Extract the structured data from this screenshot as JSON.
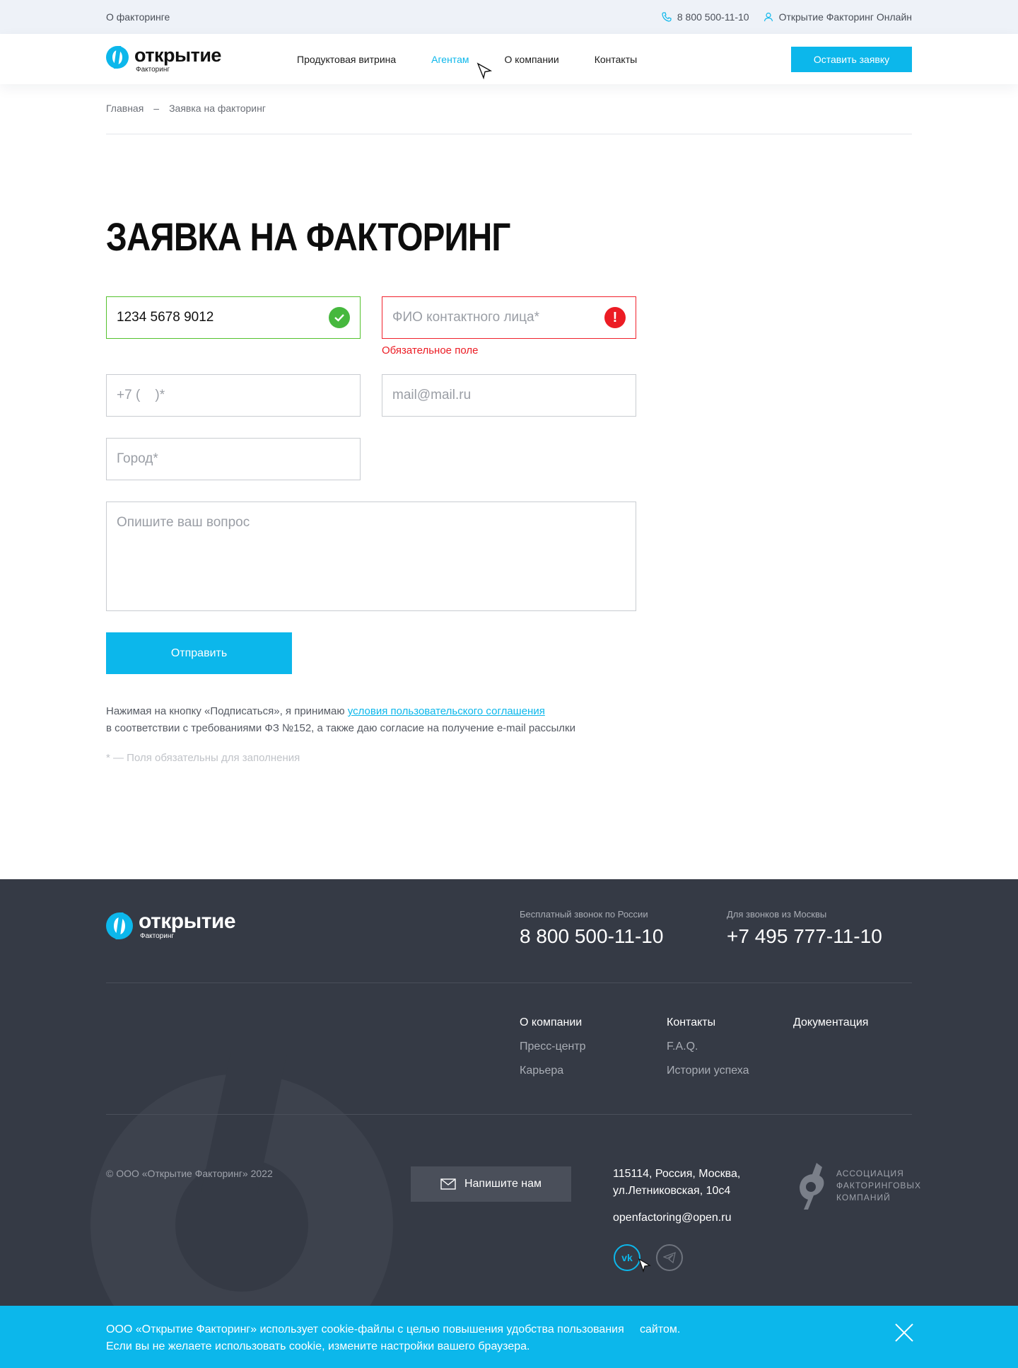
{
  "topbar": {
    "about_link": "О факторинге",
    "phone": "8 800 500-11-10",
    "online_link": "Открытие Факторинг Онлайн"
  },
  "logo": {
    "name": "открытие",
    "sub": "Факторинг"
  },
  "nav": {
    "items": [
      {
        "label": "Продуктовая витрина"
      },
      {
        "label": "Агентам"
      },
      {
        "label": "О компании"
      },
      {
        "label": "Контакты"
      }
    ],
    "cta": "Оставить заявку"
  },
  "breadcrumb": {
    "home": "Главная",
    "sep": "–",
    "current": "Заявка на факторинг"
  },
  "page_title": "Заявка на факторинг",
  "form": {
    "inn_value": "1234 5678 9012",
    "fio_placeholder": "ФИО контактного лица*",
    "fio_error": "Обязательное поле",
    "phone_placeholder": "+7 (    )*",
    "email_placeholder": "mail@mail.ru",
    "city_placeholder": "Город*",
    "question_placeholder": "Опишите ваш вопрос",
    "submit": "Отправить",
    "consent_before": "Нажимая на кнопку «Подписаться», я принимаю ",
    "consent_link": "условия пользовательского соглашения",
    "consent_after": "в соответствии с требованиями ФЗ №152, а также даю согласие на получение e-mail рассылки",
    "required_note": "* — Поля обязательны для заполнения"
  },
  "footer": {
    "logo_name": "открытие",
    "logo_sub": "Факторинг",
    "free_call_label": "Бесплатный звонок по России",
    "free_call_phone": "8 800 500-11-10",
    "moscow_label": "Для звонков из Москвы",
    "moscow_phone": "+7 495 777-11-10",
    "col1": [
      "О компании",
      "Пресс-центр",
      "Карьера"
    ],
    "col2": [
      "Контакты",
      "F.A.Q.",
      "Истории успеха"
    ],
    "col3": [
      "Документация"
    ],
    "copyright": "© ООО «Открытие Факторинг» 2022",
    "write_us": "Напишите нам",
    "address_line1": "115114, Россия, Москва,",
    "address_line2": "ул.Летниковская, 10с4",
    "email": "openfactoring@open.ru",
    "afk_line1": "АССОЦИАЦИЯ",
    "afk_line2": "ФАКТОРИНГОВЫХ",
    "afk_line3": "КОМПАНИЙ"
  },
  "cookie": {
    "line1": "ООО «Открытие Факторинг» использует cookie-файлы с целью повышения удобства пользования     сайтом.",
    "line2": "Если вы не желаете использовать cookie, измените настройки вашего браузера."
  }
}
